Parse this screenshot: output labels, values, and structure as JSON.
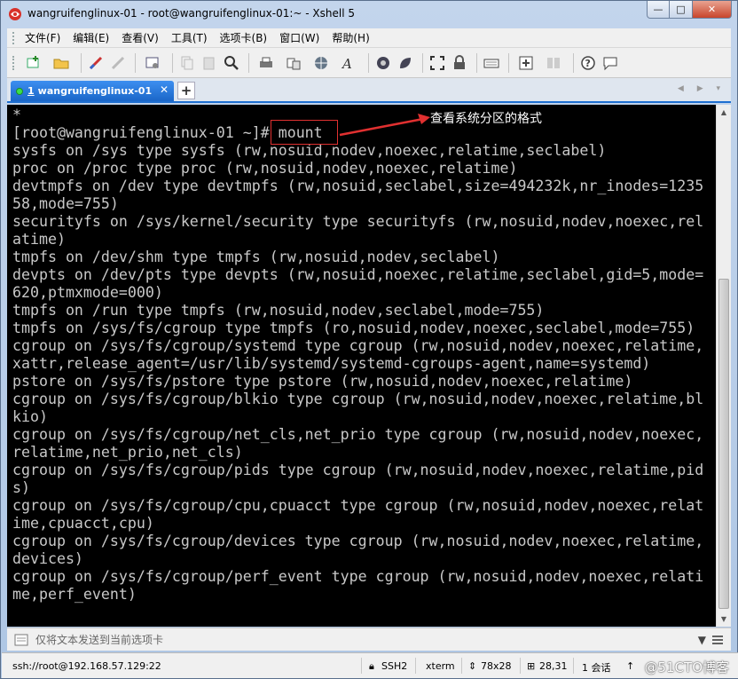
{
  "window": {
    "title": "wangruifenglinux-01 - root@wangruifenglinux-01:~ - Xshell 5",
    "controls": {
      "minimize": "—",
      "maximize": "□",
      "close": "✕"
    }
  },
  "menu": [
    "文件(F)",
    "编辑(E)",
    "查看(V)",
    "工具(T)",
    "选项卡(B)",
    "窗口(W)",
    "帮助(H)"
  ],
  "tabs": [
    {
      "number": "1",
      "label": "wangruifenglinux-01",
      "close": "✕"
    }
  ],
  "tab_add": "+",
  "tab_nav": "◀ ▶ ▾",
  "terminal": {
    "lines": [
      "*",
      "[root@wangruifenglinux-01 ~]# mount",
      "sysfs on /sys type sysfs (rw,nosuid,nodev,noexec,relatime,seclabel)",
      "proc on /proc type proc (rw,nosuid,nodev,noexec,relatime)",
      "devtmpfs on /dev type devtmpfs (rw,nosuid,seclabel,size=494232k,nr_inodes=1235",
      "58,mode=755)",
      "securityfs on /sys/kernel/security type securityfs (rw,nosuid,nodev,noexec,rel",
      "atime)",
      "tmpfs on /dev/shm type tmpfs (rw,nosuid,nodev,seclabel)",
      "devpts on /dev/pts type devpts (rw,nosuid,noexec,relatime,seclabel,gid=5,mode=",
      "620,ptmxmode=000)",
      "tmpfs on /run type tmpfs (rw,nosuid,nodev,seclabel,mode=755)",
      "tmpfs on /sys/fs/cgroup type tmpfs (ro,nosuid,nodev,noexec,seclabel,mode=755)",
      "cgroup on /sys/fs/cgroup/systemd type cgroup (rw,nosuid,nodev,noexec,relatime,",
      "xattr,release_agent=/usr/lib/systemd/systemd-cgroups-agent,name=systemd)",
      "pstore on /sys/fs/pstore type pstore (rw,nosuid,nodev,noexec,relatime)",
      "cgroup on /sys/fs/cgroup/blkio type cgroup (rw,nosuid,nodev,noexec,relatime,bl",
      "kio)",
      "cgroup on /sys/fs/cgroup/net_cls,net_prio type cgroup (rw,nosuid,nodev,noexec,",
      "relatime,net_prio,net_cls)",
      "cgroup on /sys/fs/cgroup/pids type cgroup (rw,nosuid,nodev,noexec,relatime,pid",
      "s)",
      "cgroup on /sys/fs/cgroup/cpu,cpuacct type cgroup (rw,nosuid,nodev,noexec,relat",
      "ime,cpuacct,cpu)",
      "cgroup on /sys/fs/cgroup/devices type cgroup (rw,nosuid,nodev,noexec,relatime,",
      "devices)",
      "cgroup on /sys/fs/cgroup/perf_event type cgroup (rw,nosuid,nodev,noexec,relati",
      "me,perf_event)"
    ],
    "annotation": "查看系统分区的格式",
    "text_color": "#c8c8c8",
    "annotation_color": "#e03030"
  },
  "compose": {
    "placeholder": "仅将文本发送到当前选项卡",
    "menu": "▼"
  },
  "status": {
    "connection": "ssh://root@192.168.57.129:22",
    "protocol": "SSH2",
    "terminal_type": "xterm",
    "size": "78x28",
    "cursor": "28,31",
    "sessions": "1 会话",
    "watermark": "@51CTO博客"
  },
  "colors": {
    "tab_active": "#1a66c8",
    "terminal_bg": "#000000",
    "accent": "#1e6fd0"
  }
}
